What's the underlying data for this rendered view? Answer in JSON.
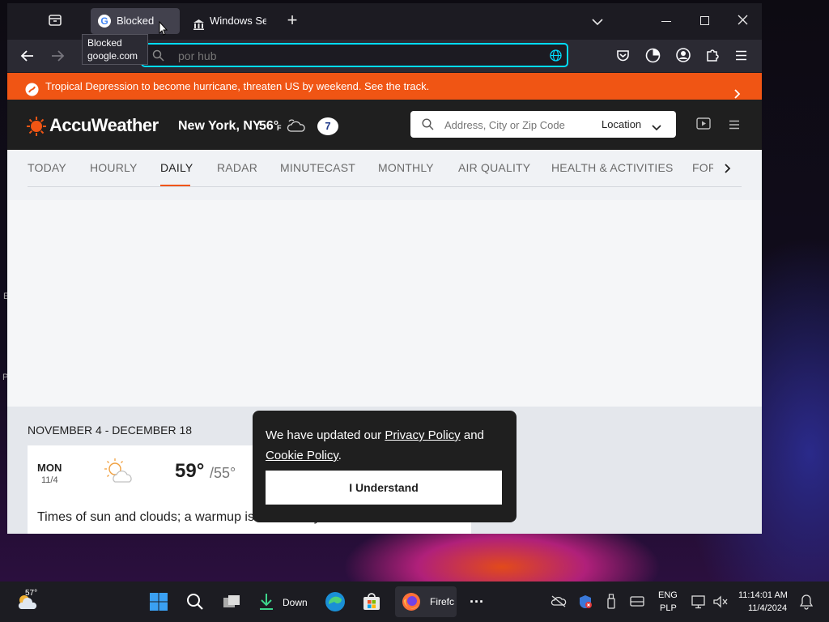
{
  "browser": {
    "tabs": [
      {
        "label": "Blocked",
        "favicon": "google-icon"
      },
      {
        "label": "Windows Ser",
        "favicon": "bank-icon"
      }
    ],
    "tooltip": {
      "title": "Blocked",
      "url": "google.com"
    },
    "urlbar": {
      "placeholder": "por hub"
    }
  },
  "alert": {
    "text": "Tropical Depression to become hurricane, threaten US by weekend. See the track."
  },
  "accuweather": {
    "brand": "AccuWeather",
    "location": "New York, NY",
    "temp": "56°",
    "unit": "F",
    "search_placeholder": "Address, City or Zip Code",
    "location_button": "Location"
  },
  "subnav": {
    "items": [
      "TODAY",
      "HOURLY",
      "DAILY",
      "RADAR",
      "MINUTECAST",
      "MONTHLY",
      "AIR QUALITY",
      "HEALTH & ACTIVITIES",
      "FOR"
    ],
    "active_index": 2
  },
  "forecast": {
    "range": "NOVEMBER 4 - DECEMBER 18",
    "day": {
      "dow": "MON",
      "date": "11/4",
      "high": "59°",
      "low": "/55°",
      "phrase": "Times of sun and clouds; a warmup is on the way"
    }
  },
  "cookie": {
    "text_before": "We have updated our ",
    "privacy_link": "Privacy Policy",
    "text_and": " and",
    "cookie_link": "Cookie Policy",
    "text_after": ".",
    "button": "I Understand"
  },
  "taskbar": {
    "weather_temp": "57°",
    "download_label": "Down",
    "firefox_label": "Firefc",
    "lang": "ENG",
    "layout": "PLP",
    "time": "11:14:01 AM",
    "date": "11/4/2024"
  },
  "colors": {
    "accent": "#f05514",
    "url_focus": "#00ddff"
  }
}
